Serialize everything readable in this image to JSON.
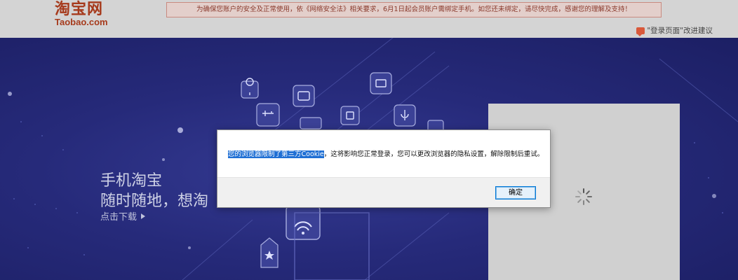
{
  "header": {
    "logo_cn": "淘宝网",
    "logo_en": "Taobao.com",
    "notice": "为确保您账户的安全及正常使用，依《网络安全法》相关要求，6月1日起会员账户需绑定手机。如您还未绑定，请尽快完成，感谢您的理解及支持！",
    "feedback": "\"登录页面\"改进建议",
    "feedback_icon": "chat-bubble-icon"
  },
  "hero": {
    "line1": "手机淘宝",
    "line2": "随时随地，想淘",
    "download": "点击下载",
    "download_icon": "play-triangle-icon"
  },
  "login_panel": {
    "state": "loading",
    "icon": "spinner-icon"
  },
  "dialog": {
    "message_highlight": "您的浏览器限制了第三方Cookie",
    "message_rest": "，这将影响您正常登录，您可以更改浏览器的隐私设置，解除限制后重试。",
    "ok_label": "确定"
  },
  "colors": {
    "brand": "#a63a1c",
    "hero_bg": "#262a7a",
    "highlight": "#1f6fd4",
    "button_border": "#0078d7"
  }
}
